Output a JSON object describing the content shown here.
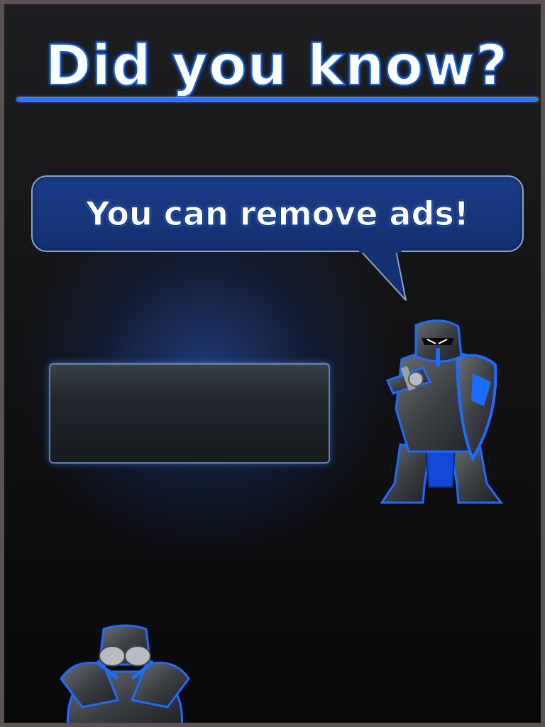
{
  "screen": {
    "title": "Did you know?",
    "tip_text": "You can remove ads!"
  },
  "colors": {
    "accent_blue": "#1c78ff",
    "bubble_fill": "#1a3c88",
    "bubble_border": "#8da3c9",
    "panel_border": "#5a7fb8",
    "background_dark": "#141416",
    "frame": "#5b5252"
  },
  "icons": {
    "speech_bubble": "speech-bubble-icon",
    "mascot_standing": "knight-mascot-icon",
    "mascot_facepalm": "knight-facepalm-icon"
  }
}
